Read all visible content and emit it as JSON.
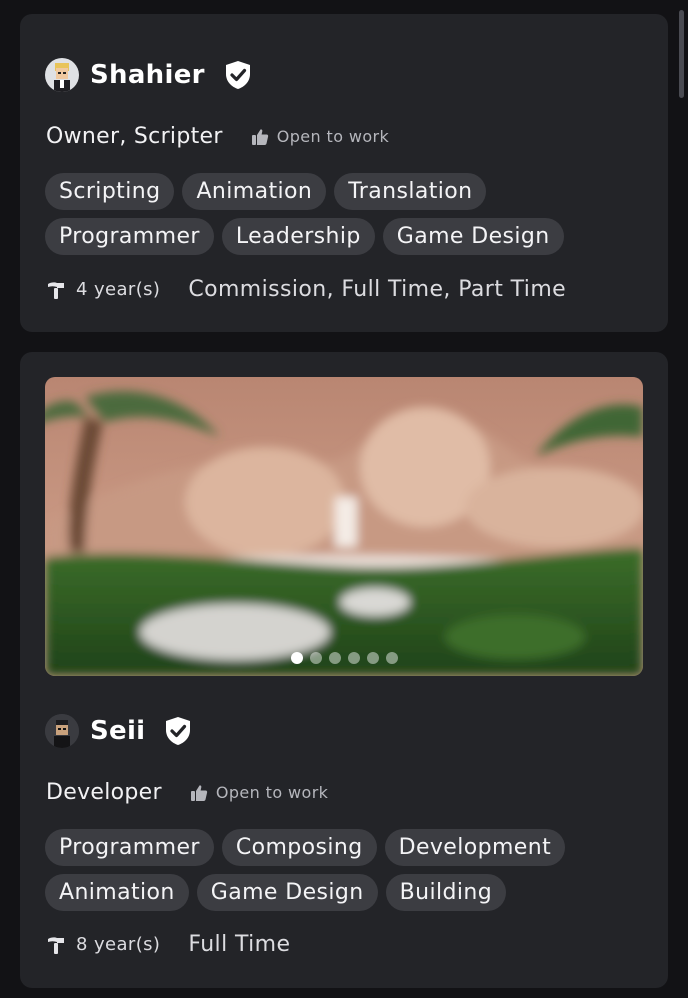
{
  "listings": [
    {
      "username": "Shahier",
      "role": "Owner, Scripter",
      "status": "Open to work",
      "skills": [
        "Scripting",
        "Animation",
        "Translation",
        "Programmer",
        "Leadership",
        "Game Design"
      ],
      "experience": "4 year(s)",
      "employment_types": "Commission, Full Time, Part Time",
      "verified_icon": "shield-check-icon",
      "status_icon": "thumbs-up-icon",
      "experience_icon": "hammer-icon"
    },
    {
      "username": "Seii",
      "role": "Developer",
      "status": "Open to work",
      "skills": [
        "Programmer",
        "Composing",
        "Development",
        "Animation",
        "Game Design",
        "Building"
      ],
      "experience": "8 year(s)",
      "employment_types": "Full Time",
      "verified_icon": "shield-check-icon",
      "status_icon": "thumbs-up-icon",
      "experience_icon": "hammer-icon",
      "gallery": {
        "slide_count": 6,
        "active_slide": 1
      }
    }
  ],
  "colors": {
    "background": "#121215",
    "card": "#232428",
    "tag": "#3c3d42",
    "muted_text": "#b5b6bc"
  }
}
